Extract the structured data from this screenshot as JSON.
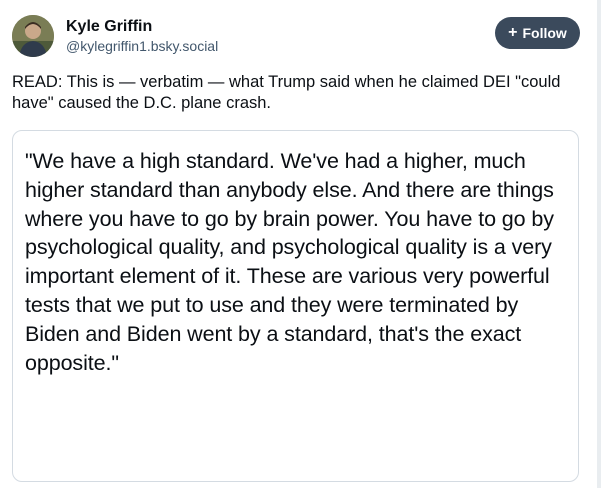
{
  "author": {
    "display_name": "Kyle Griffin",
    "handle": "@kylegriffin1.bsky.social"
  },
  "follow_button": {
    "icon": "plus-icon",
    "label": "Follow"
  },
  "post": {
    "text": "READ: This is — verbatim — what Trump said when he claimed DEI \"could have\" caused the D.C. plane crash."
  },
  "quote_card": {
    "text": "\"We have a high standard. We've had a higher, much higher standard than anybody else. And there are things where you have to go by brain power. You have to go by psychological quality, and psychological quality is a very important element of it. These are various very powerful tests that we put to use and they were terminated by Biden and Biden went by a standard, that's the exact opposite.\""
  },
  "colors": {
    "follow_bg": "#3b4a5c",
    "handle": "#42576c",
    "card_border": "#d4dbe2"
  }
}
